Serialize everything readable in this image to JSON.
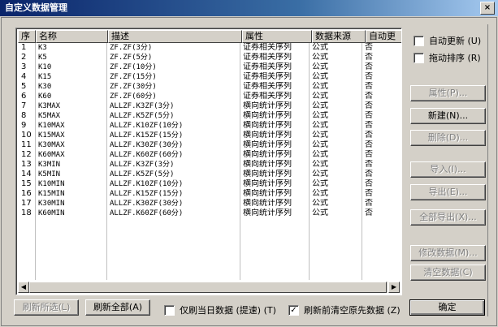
{
  "window": {
    "title": "自定义数据管理",
    "close_glyph": "×"
  },
  "list": {
    "columns": [
      "序",
      "名称",
      "描述",
      "属性",
      "数据来源",
      "自动更"
    ],
    "rows": [
      [
        "1",
        "K3",
        "ZF.ZF(3分)",
        "证券相关序列",
        "公式",
        "否"
      ],
      [
        "2",
        "K5",
        "ZF.ZF(5分)",
        "证券相关序列",
        "公式",
        "否"
      ],
      [
        "3",
        "K10",
        "ZF.ZF(10分)",
        "证券相关序列",
        "公式",
        "否"
      ],
      [
        "4",
        "K15",
        "ZF.ZF(15分)",
        "证券相关序列",
        "公式",
        "否"
      ],
      [
        "5",
        "K30",
        "ZF.ZF(30分)",
        "证券相关序列",
        "公式",
        "否"
      ],
      [
        "6",
        "K60",
        "ZF.ZF(60分)",
        "证券相关序列",
        "公式",
        "否"
      ],
      [
        "7",
        "K3MAX",
        "ALLZF.K3ZF(3分)",
        "横向统计序列",
        "公式",
        "否"
      ],
      [
        "8",
        "K5MAX",
        "ALLZF.K5ZF(5分)",
        "横向统计序列",
        "公式",
        "否"
      ],
      [
        "9",
        "K10MAX",
        "ALLZF.K10ZF(10分)",
        "横向统计序列",
        "公式",
        "否"
      ],
      [
        "10",
        "K15MAX",
        "ALLZF.K15ZF(15分)",
        "横向统计序列",
        "公式",
        "否"
      ],
      [
        "11",
        "K30MAX",
        "ALLZF.K30ZF(30分)",
        "横向统计序列",
        "公式",
        "否"
      ],
      [
        "12",
        "K60MAX",
        "ALLZF.K60ZF(60分)",
        "横向统计序列",
        "公式",
        "否"
      ],
      [
        "13",
        "K3MIN",
        "ALLZF.K3ZF(3分)",
        "横向统计序列",
        "公式",
        "否"
      ],
      [
        "14",
        "K5MIN",
        "ALLZF.K5ZF(5分)",
        "横向统计序列",
        "公式",
        "否"
      ],
      [
        "15",
        "K10MIN",
        "ALLZF.K10ZF(10分)",
        "横向统计序列",
        "公式",
        "否"
      ],
      [
        "16",
        "K15MIN",
        "ALLZF.K15ZF(15分)",
        "横向统计序列",
        "公式",
        "否"
      ],
      [
        "17",
        "K30MIN",
        "ALLZF.K30ZF(30分)",
        "横向统计序列",
        "公式",
        "否"
      ],
      [
        "18",
        "K60MIN",
        "ALLZF.K60ZF(60分)",
        "横向统计序列",
        "公式",
        "否"
      ]
    ]
  },
  "options": {
    "auto_update": "自动更新 (U)",
    "drag_sort": "拖动排序 (R)"
  },
  "side_buttons": {
    "properties": "属性(P)...",
    "new": "新建(N)...",
    "delete": "删除(D)...",
    "import": "导入(I)...",
    "export": "导出(E)...",
    "export_all": "全部导出(X)...",
    "modify": "修改数据(M)...",
    "clear": "清空数据(C)"
  },
  "bottom": {
    "refresh_selected": "刷新所选(L)",
    "refresh_all": "刷新全部(A)",
    "today_only": "仅刷当日数据 (提速) (T)",
    "today_only_checked": false,
    "clear_before_refresh": "刷新前清空原先数据 (Z)",
    "clear_before_refresh_checked": true,
    "ok": "确定"
  },
  "glyphs": {
    "left_arrow": "◀",
    "right_arrow": "▶",
    "check": "✓"
  }
}
